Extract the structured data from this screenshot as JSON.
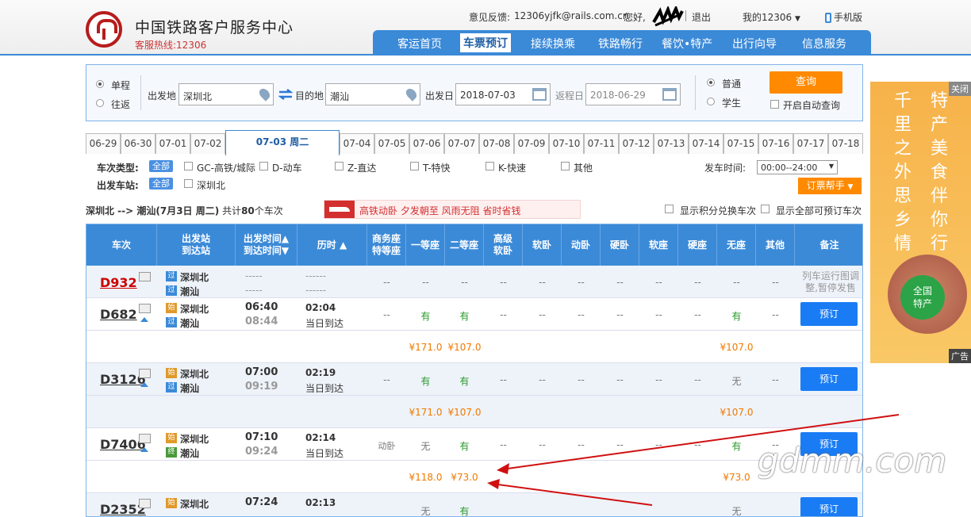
{
  "header": {
    "site_title": "中国铁路客户服务中心",
    "hotline": "客服热线:12306",
    "feedback_label": "意见反馈:",
    "feedback_email": "12306yjfk@rails.com.cn",
    "greeting": "您好,",
    "logout": "退出",
    "my12306": "我的12306",
    "mobile": "手机版",
    "nav": [
      "客运首页",
      "车票预订",
      "接续换乘",
      "铁路畅行",
      "餐饮•特产",
      "出行向导",
      "信息服务"
    ]
  },
  "search": {
    "trip_oneway": "单程",
    "trip_round": "往返",
    "from_label": "出发地",
    "from_value": "深圳北",
    "to_label": "目的地",
    "to_value": "潮汕",
    "depart_label": "出发日",
    "depart_value": "2018-07-03",
    "return_label": "返程日",
    "return_value": "2018-06-29",
    "ticket_normal": "普通",
    "ticket_student": "学生",
    "query_button": "查询",
    "auto_query": "开启自动查询"
  },
  "dates": [
    "06-29",
    "06-30",
    "07-01",
    "07-02",
    "07-03 周二",
    "07-04",
    "07-05",
    "07-06",
    "07-07",
    "07-08",
    "07-09",
    "07-10",
    "07-11",
    "07-12",
    "07-13",
    "07-14",
    "07-15",
    "07-16",
    "07-17",
    "07-18"
  ],
  "filters": {
    "type_label": "车次类型:",
    "all": "全部",
    "types": [
      "GC-高铁/城际",
      "D-动车",
      "Z-直达",
      "T-特快",
      "K-快速",
      "其他"
    ],
    "station_label": "出发车站:",
    "station_option": "深圳北",
    "time_label": "发车时间:",
    "time_value": "00:00--24:00",
    "helper": "订票帮手"
  },
  "summary": {
    "route": "深圳北 --> 潮汕",
    "date": "(7月3日  周二)",
    "count_prefix": "共计",
    "count": "80",
    "count_suffix": "个车次",
    "banner": "高铁动卧 夕发朝至 风雨无阻 省时省钱",
    "opt_points": "显示积分兑换车次",
    "opt_all": "显示全部可预订车次"
  },
  "table": {
    "headers": [
      "车次",
      "出发站\n到达站",
      "出发时间▲\n到达时间▼",
      "历时 ▲",
      "商务座\n特等座",
      "一等座",
      "二等座",
      "高级\n软卧",
      "软卧",
      "动卧",
      "硬卧",
      "软座",
      "硬座",
      "无座",
      "其他",
      "备注"
    ],
    "rows": [
      {
        "code": "D932",
        "from": "深圳北",
        "to": "潮汕",
        "from_tag": "过",
        "to_tag": "过",
        "dep": "-----",
        "arr": "-----",
        "dur": "------",
        "dur2": "------",
        "seats": [
          "--",
          "--",
          "--",
          "--",
          "--",
          "--",
          "--",
          "--",
          "--",
          "--",
          "--"
        ],
        "note": "列车运行图调整,暂停发售"
      },
      {
        "code": "D682",
        "from": "深圳北",
        "to": "潮汕",
        "from_tag": "始",
        "to_tag": "过",
        "dep": "06:40",
        "arr": "08:44",
        "dur": "02:04",
        "dur2": "当日到达",
        "seats": [
          "--",
          "有",
          "有",
          "--",
          "--",
          "--",
          "--",
          "--",
          "--",
          "有",
          "--"
        ],
        "prices": [
          "",
          "¥171.0",
          "¥107.0",
          "",
          "",
          "",
          "",
          "",
          "",
          "¥107.0",
          ""
        ],
        "book": "预订"
      },
      {
        "code": "D3126",
        "from": "深圳北",
        "to": "潮汕",
        "from_tag": "始",
        "to_tag": "过",
        "dep": "07:00",
        "arr": "09:19",
        "dur": "02:19",
        "dur2": "当日到达",
        "seats": [
          "--",
          "有",
          "有",
          "--",
          "--",
          "--",
          "--",
          "--",
          "--",
          "无",
          "--"
        ],
        "prices": [
          "",
          "¥171.0",
          "¥107.0",
          "",
          "",
          "",
          "",
          "",
          "",
          "¥107.0",
          ""
        ],
        "book": "预订"
      },
      {
        "code": "D7406",
        "from": "深圳北",
        "to": "潮汕",
        "from_tag": "始",
        "to_tag": "终",
        "dep": "07:10",
        "arr": "09:24",
        "dur": "02:14",
        "dur2": "当日到达",
        "seats": [
          "动卧",
          "无",
          "有",
          "--",
          "--",
          "--",
          "--",
          "--",
          "--",
          "有",
          "--"
        ],
        "prices": [
          "",
          "¥118.0",
          "¥73.0",
          "",
          "",
          "",
          "",
          "",
          "",
          "¥73.0",
          ""
        ],
        "book": "预订"
      },
      {
        "code": "D2352",
        "from": "深圳北",
        "to": "",
        "from_tag": "始",
        "to_tag": "",
        "dep": "07:24",
        "arr": "",
        "dur": "02:13",
        "dur2": "",
        "seats": [
          "",
          "无",
          "有",
          "",
          "",
          "",
          "",
          "",
          "",
          "无",
          ""
        ],
        "book": "预订"
      }
    ]
  },
  "ad": {
    "col1": "千里之外思乡情",
    "col2": "特产美食伴你行",
    "close": "关闭",
    "badge": "全国\n特产",
    "label": "广告"
  },
  "watermark": "gdmm.com"
}
